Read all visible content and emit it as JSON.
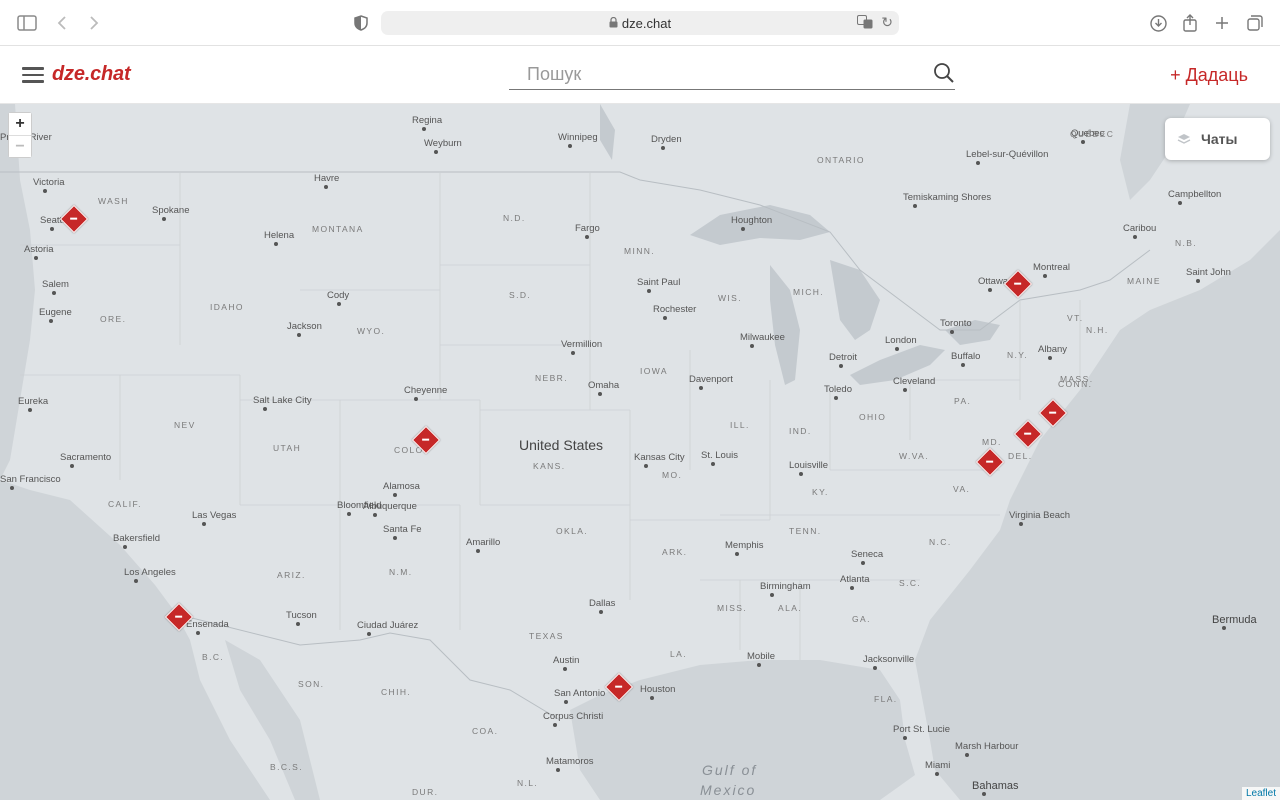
{
  "browser": {
    "url": "dze.chat"
  },
  "header": {
    "logo": "dze.chat",
    "search_placeholder": "Пошук",
    "add_label": "+ Дадаць"
  },
  "map": {
    "zoom_in": "+",
    "zoom_out": "−",
    "layers_label": "Чаты",
    "attribution": "Leaflet",
    "country_label": "United States",
    "sea_label_1": "Gulf of",
    "sea_label_2": "Mexico",
    "cities": [
      "Seattle",
      "Spokane",
      "Havre",
      "Helena",
      "Winnipeg",
      "Regina",
      "Weyburn",
      "Dryden",
      "Victoria",
      "Astoria",
      "Salem",
      "Eugene",
      "Eureka",
      "Sacramento",
      "San Francisco",
      "Bakersfield",
      "Los Angeles",
      "Ensenada",
      "Las Vegas",
      "Tucson",
      "Ciudad Juárez",
      "Santa Fe",
      "Albuquerque",
      "Amarillo",
      "Dallas",
      "Austin",
      "San Antonio",
      "Corpus Christi",
      "Matamoros",
      "Houston",
      "Salt Lake City",
      "Cheyenne",
      "Cody",
      "Jackson",
      "Bloomfield",
      "Alamosa",
      "Fargo",
      "Saint Paul",
      "Rochester",
      "Vermillion",
      "Omaha",
      "Kansas City",
      "St. Louis",
      "Davenport",
      "Milwaukee",
      "Houghton",
      "Detroit",
      "Toledo",
      "Cleveland",
      "Louisville",
      "Memphis",
      "Birmingham",
      "Atlanta",
      "Seneca",
      "Mobile",
      "Jacksonville",
      "Port St. Lucie",
      "Miami",
      "Marsh Harbour",
      "Bahamas",
      "Bermuda",
      "Virginia Beach",
      "Albany",
      "Buffalo",
      "Toronto",
      "London",
      "Ottawa",
      "Montreal",
      "Quebec",
      "Campbellton",
      "Caribou",
      "Saint John",
      "Temiskaming Shores",
      "Lebel-sur-Quévillon",
      "Prince River"
    ],
    "regions": [
      "WASH",
      "MONTANA",
      "IDAHO",
      "ORE.",
      "WYO.",
      "NEV",
      "UTAH",
      "COLO.",
      "CALIF.",
      "ARIZ.",
      "N.M.",
      "TEXAS",
      "OKLA.",
      "KANS.",
      "NEBR.",
      "S.D.",
      "N.D.",
      "MINN.",
      "IOWA",
      "WIS.",
      "MICH.",
      "ILL.",
      "IND.",
      "OHIO",
      "MO.",
      "KY.",
      "TENN.",
      "ARK.",
      "MISS.",
      "ALA.",
      "GA.",
      "FLA.",
      "LA.",
      "S.C.",
      "N.C.",
      "VA.",
      "W.VA.",
      "PA.",
      "N.Y.",
      "VT.",
      "N.H.",
      "MAINE",
      "MASS.",
      "CONN.",
      "MD.",
      "DEL.",
      "ONTARIO",
      "QUÉBEC",
      "SON.",
      "CHIH.",
      "COA.",
      "DUR.",
      "B.C.",
      "B.C.S.",
      "N.L.",
      "N.B."
    ],
    "markers": [
      "Seattle",
      "San Diego",
      "Colorado",
      "Houston",
      "Ottawa",
      "New York",
      "New Jersey",
      "Washington DC"
    ]
  }
}
